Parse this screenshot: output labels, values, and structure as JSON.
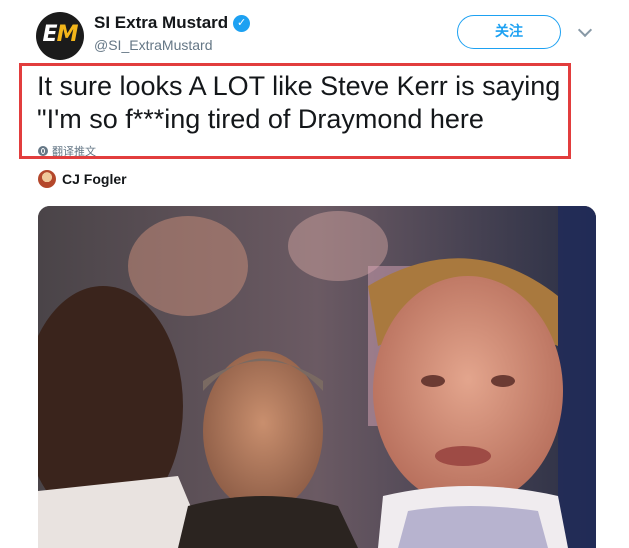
{
  "tweet": {
    "display_name": "SI Extra Mustard",
    "handle": "@SI_ExtraMustard",
    "avatar_icon": "si-extra-mustard-logo",
    "avatar_letters": "EM",
    "follow_label": "关注",
    "text": "It sure looks A LOT like Steve Kerr is saying\n\"I'm so f***ing tired of Draymond here",
    "translate_label": "翻译推文",
    "accent_color": "#1da1f2",
    "highlight_color": "#e23d3d"
  },
  "quoted": {
    "name": "CJ Fogler"
  },
  "media": {
    "type": "video-frame",
    "description_icon": "video-still"
  }
}
